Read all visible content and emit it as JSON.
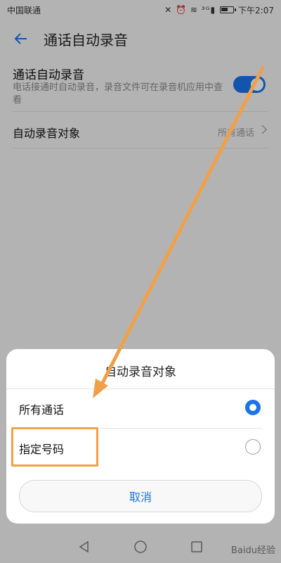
{
  "status_bar": {
    "carrier": "中国联通",
    "icons": "✕ ⏰ ≋ ³ᴳ▮",
    "time": "下午2:07"
  },
  "app_bar": {
    "title": "通话自动录音"
  },
  "settings": {
    "auto_record": {
      "title": "通话自动录音",
      "description": "电话接通时自动录音，录音文件可在录音机应用中查看",
      "enabled": true
    },
    "record_target": {
      "label": "自动录音对象",
      "value": "所有通话"
    }
  },
  "dialog": {
    "title": "自动录音对象",
    "options": [
      {
        "label": "所有通话",
        "selected": true
      },
      {
        "label": "指定号码",
        "selected": false
      }
    ],
    "cancel_label": "取消"
  },
  "watermark": "Baidu经验",
  "colors": {
    "accent": "#1a73e8",
    "annotation": "#f0a048"
  }
}
